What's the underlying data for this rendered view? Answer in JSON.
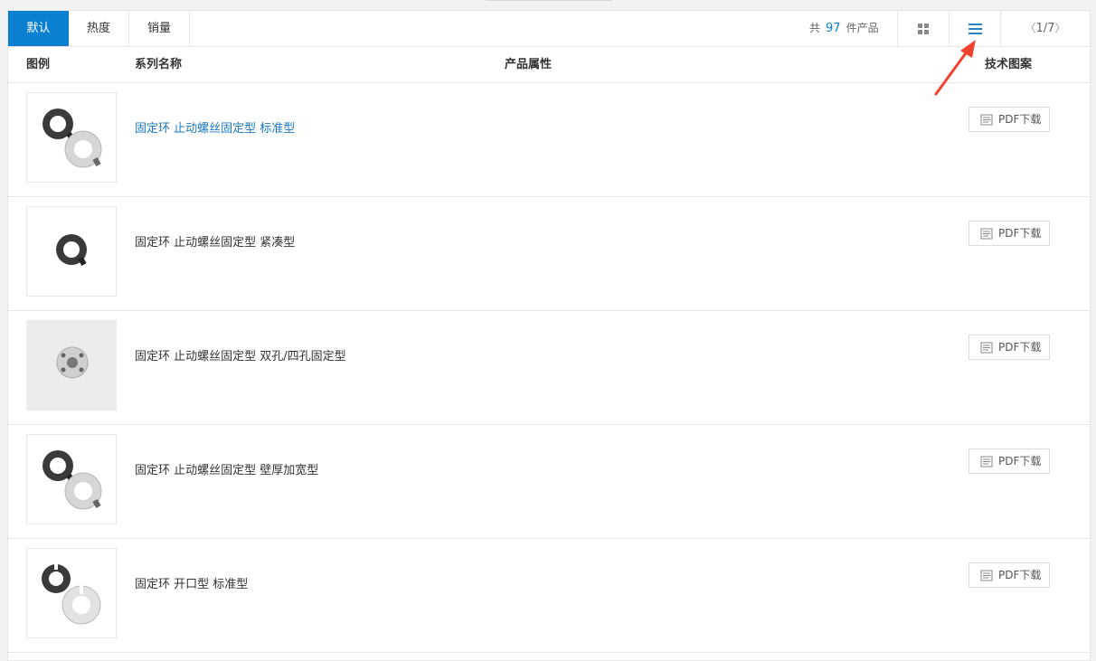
{
  "toolbar": {
    "sort_tabs": [
      {
        "label": "默认",
        "active": true
      },
      {
        "label": "热度",
        "active": false
      },
      {
        "label": "销量",
        "active": false
      }
    ],
    "count_prefix": "共",
    "count_value": "97",
    "count_suffix": "件产品",
    "view_grid_icon": "grid-view-icon",
    "view_list_icon": "list-view-icon",
    "pager": {
      "prev": "〈",
      "text": "1/7",
      "next": "〉"
    }
  },
  "columns": {
    "image": "图例",
    "series_name": "系列名称",
    "attributes": "产品属性",
    "drawing": "技术图案"
  },
  "products": [
    {
      "name": "固定环 止动螺丝固定型 标准型",
      "pdf_label": "PDF下载",
      "thumb": "two-rings"
    },
    {
      "name": "固定环 止动螺丝固定型 紧凑型",
      "pdf_label": "PDF下载",
      "thumb": "one-ring"
    },
    {
      "name": "固定环 止动螺丝固定型 双孔/四孔固定型",
      "pdf_label": "PDF下载",
      "thumb": "flange"
    },
    {
      "name": "固定环 止动螺丝固定型 壁厚加宽型",
      "pdf_label": "PDF下载",
      "thumb": "two-rings"
    },
    {
      "name": "固定环 开口型 标准型",
      "pdf_label": "PDF下载",
      "thumb": "split-rings"
    }
  ],
  "colors": {
    "accent": "#0b7fd0",
    "link_hover": "#1b7ac4",
    "annotation_arrow": "#f0432e"
  }
}
